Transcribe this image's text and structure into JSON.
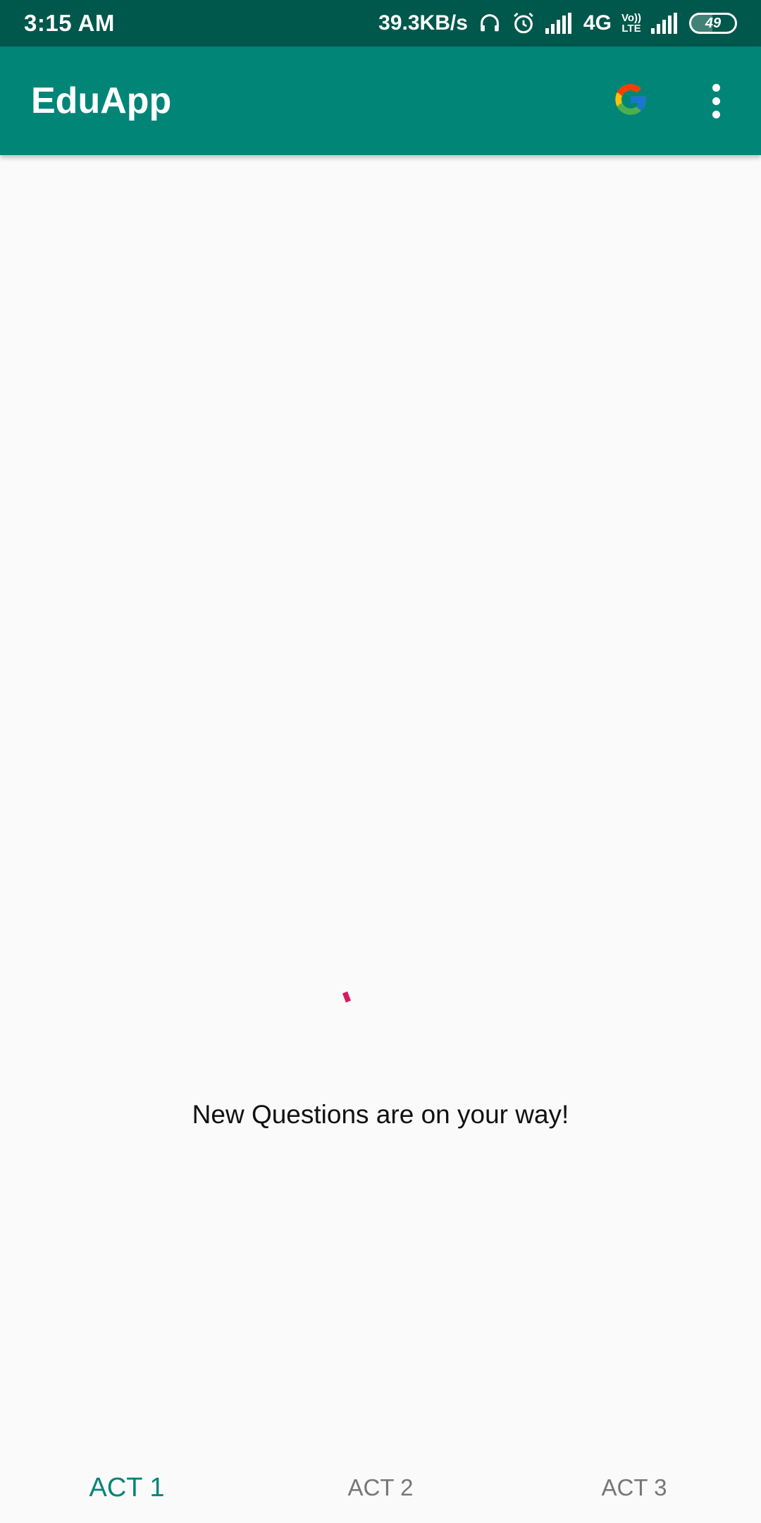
{
  "status_bar": {
    "time": "3:15 AM",
    "network_speed": "39.3KB/s",
    "network_type": "4G",
    "volte_top": "Vo))",
    "volte_bottom": "LTE",
    "battery_level": "49",
    "icons": [
      "headset-icon",
      "alarm-icon",
      "signal-icon",
      "volte-icon",
      "signal-icon",
      "battery-icon"
    ]
  },
  "app_bar": {
    "title": "EduApp",
    "google_icon": "google-g-icon",
    "overflow_icon": "more-vert-icon"
  },
  "content": {
    "loading_message": "New Questions are on your way!",
    "spinner_color": "#d81b60"
  },
  "tabs": [
    {
      "label": "ACT 1",
      "active": true
    },
    {
      "label": "ACT 2",
      "active": false
    },
    {
      "label": "ACT 3",
      "active": false
    }
  ],
  "colors": {
    "primary": "#008577",
    "primary_dark": "#00574b",
    "accent": "#d81b60"
  }
}
